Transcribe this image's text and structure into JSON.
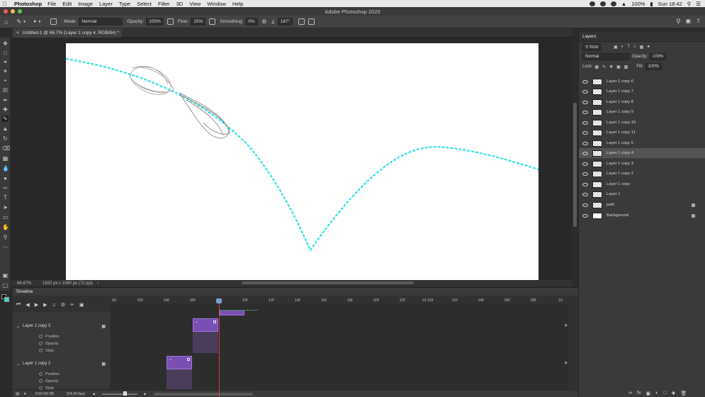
{
  "menubar": {
    "app": "Photoshop",
    "items": [
      "File",
      "Edit",
      "Image",
      "Layer",
      "Type",
      "Select",
      "Filter",
      "3D",
      "View",
      "Window",
      "Help"
    ],
    "battery": "100%",
    "clock": "Sun 18:42"
  },
  "window": {
    "title": "Adobe Photoshop 2020"
  },
  "options": {
    "mode_label": "Mode:",
    "mode_value": "Normal",
    "opacity_label": "Opacity:",
    "opacity_value": "100%",
    "flow_label": "Flow:",
    "flow_value": "25%",
    "smoothing_label": "Smoothing:",
    "smoothing_value": "0%",
    "angle_value": "187°"
  },
  "document": {
    "tab": "Untitled-1 @ 66.7% (Layer 1 copy 4, RGB/8#) *",
    "zoom": "66.67%",
    "size": "1920 px x 1080 px (72 ppi)"
  },
  "layers_panel": {
    "title": "Layers",
    "kind_label": "Kind",
    "blend": "Normal",
    "opacity_label": "Opacity:",
    "opacity_value": "100%",
    "lock_label": "Lock:",
    "fill_label": "Fill:",
    "fill_value": "100%",
    "layers": [
      {
        "name": "Layer 1 copy 6",
        "selected": false
      },
      {
        "name": "Layer 1 copy 7",
        "selected": false
      },
      {
        "name": "Layer 1 copy 8",
        "selected": false
      },
      {
        "name": "Layer 1 copy 9",
        "selected": false
      },
      {
        "name": "Layer 1 copy 10",
        "selected": false
      },
      {
        "name": "Layer 1 copy 11",
        "selected": false
      },
      {
        "name": "Layer 1 copy 5",
        "selected": false
      },
      {
        "name": "Layer 1 copy 4",
        "selected": true
      },
      {
        "name": "Layer 1 copy 3",
        "selected": false
      },
      {
        "name": "Layer 1 copy 2",
        "selected": false
      },
      {
        "name": "Layer 1 copy",
        "selected": false
      },
      {
        "name": "Layer 1",
        "selected": false
      },
      {
        "name": "path",
        "selected": false,
        "locked": true
      },
      {
        "name": "Background",
        "selected": false,
        "locked": true
      }
    ]
  },
  "timeline": {
    "title": "Timeline",
    "ruler": [
      "00",
      "02f",
      "04f",
      "06f",
      "08f",
      "10f",
      "12f",
      "14f",
      "16f",
      "18f",
      "20f",
      "22f",
      "01:00f",
      "02f",
      "04f",
      "06f",
      "08f",
      "10"
    ],
    "groups": [
      {
        "name": "Layer 1 copy 3",
        "props": [
          "Position",
          "Opacity",
          "Style"
        ]
      },
      {
        "name": "Layer 1 copy 2",
        "props": [
          "Position",
          "Opacity",
          "Style"
        ]
      }
    ],
    "timecode": "0:00:00:08",
    "fps": "(24.00 fps)"
  },
  "colors": {
    "path": "#2fe3df",
    "clip": "#7a4fb5",
    "playhead": "#d04040",
    "foreground": "#111111",
    "background": "#28e0d6"
  }
}
